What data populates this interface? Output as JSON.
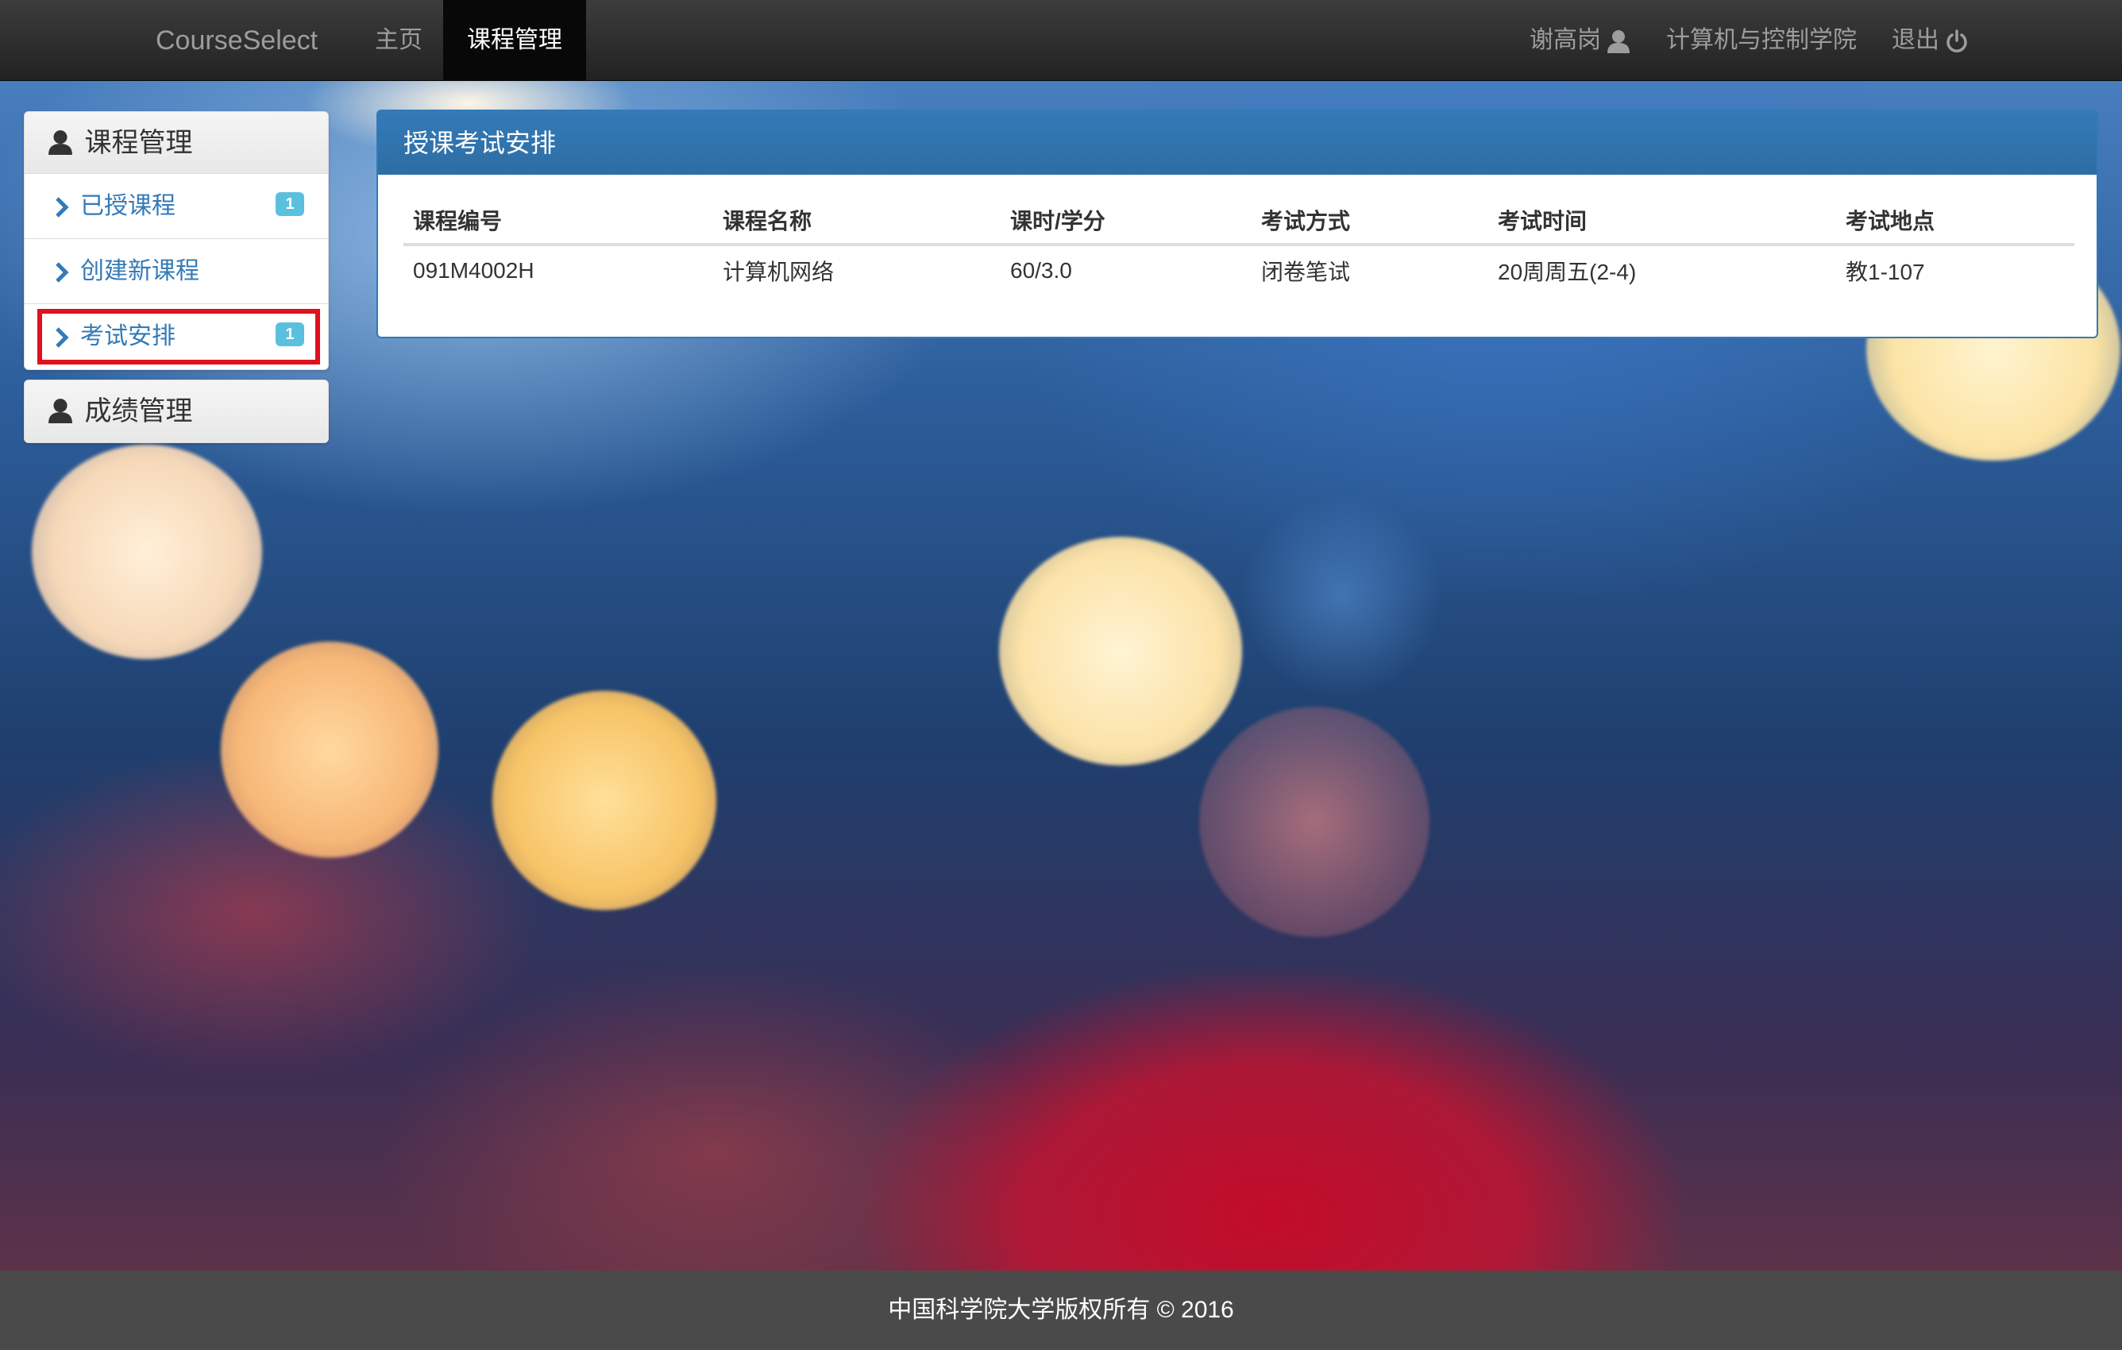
{
  "navbar": {
    "brand": "CourseSelect",
    "links": [
      "主页",
      "课程管理"
    ],
    "user": "谢高岗",
    "college": "计算机与控制学院",
    "logout": "退出"
  },
  "sidebar": {
    "course_mgmt": {
      "title": "课程管理",
      "items": [
        {
          "label": "已授课程",
          "badge": "1"
        },
        {
          "label": "创建新课程"
        },
        {
          "label": "考试安排",
          "badge": "1"
        }
      ]
    },
    "grade_mgmt": {
      "title": "成绩管理"
    }
  },
  "main": {
    "title": "授课考试安排",
    "columns": [
      "课程编号",
      "课程名称",
      "课时/学分",
      "考试方式",
      "考试时间",
      "考试地点"
    ],
    "rows": [
      [
        "091M4002H",
        "计算机网络",
        "60/3.0",
        "闭卷笔试",
        "20周周五(2-4)",
        "教1-107"
      ]
    ]
  },
  "footer": {
    "text": "中国科学院大学版权所有 © 2016"
  },
  "colors": {
    "primary": "#337ab7",
    "badge": "#5bc0de",
    "highlight": "#e0101f",
    "navbar": "#222222"
  }
}
